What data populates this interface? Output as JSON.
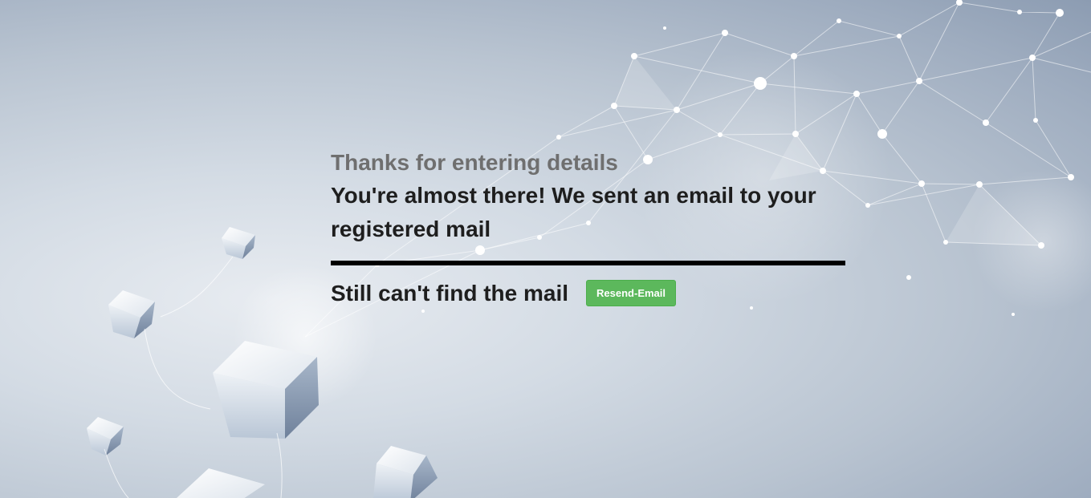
{
  "confirmation": {
    "subtitle": "Thanks for entering details",
    "headline": "You're almost there! We sent an email to your registered mail",
    "resend_prompt": "Still can't find the mail",
    "resend_button_label": "Resend-Email"
  },
  "colors": {
    "button_bg": "#5cb85c",
    "subtitle_text": "#6f6f6f",
    "headline_text": "#1e1e1e",
    "divider": "#000000"
  },
  "icons": {
    "background": "network-and-cubes-illustration"
  }
}
